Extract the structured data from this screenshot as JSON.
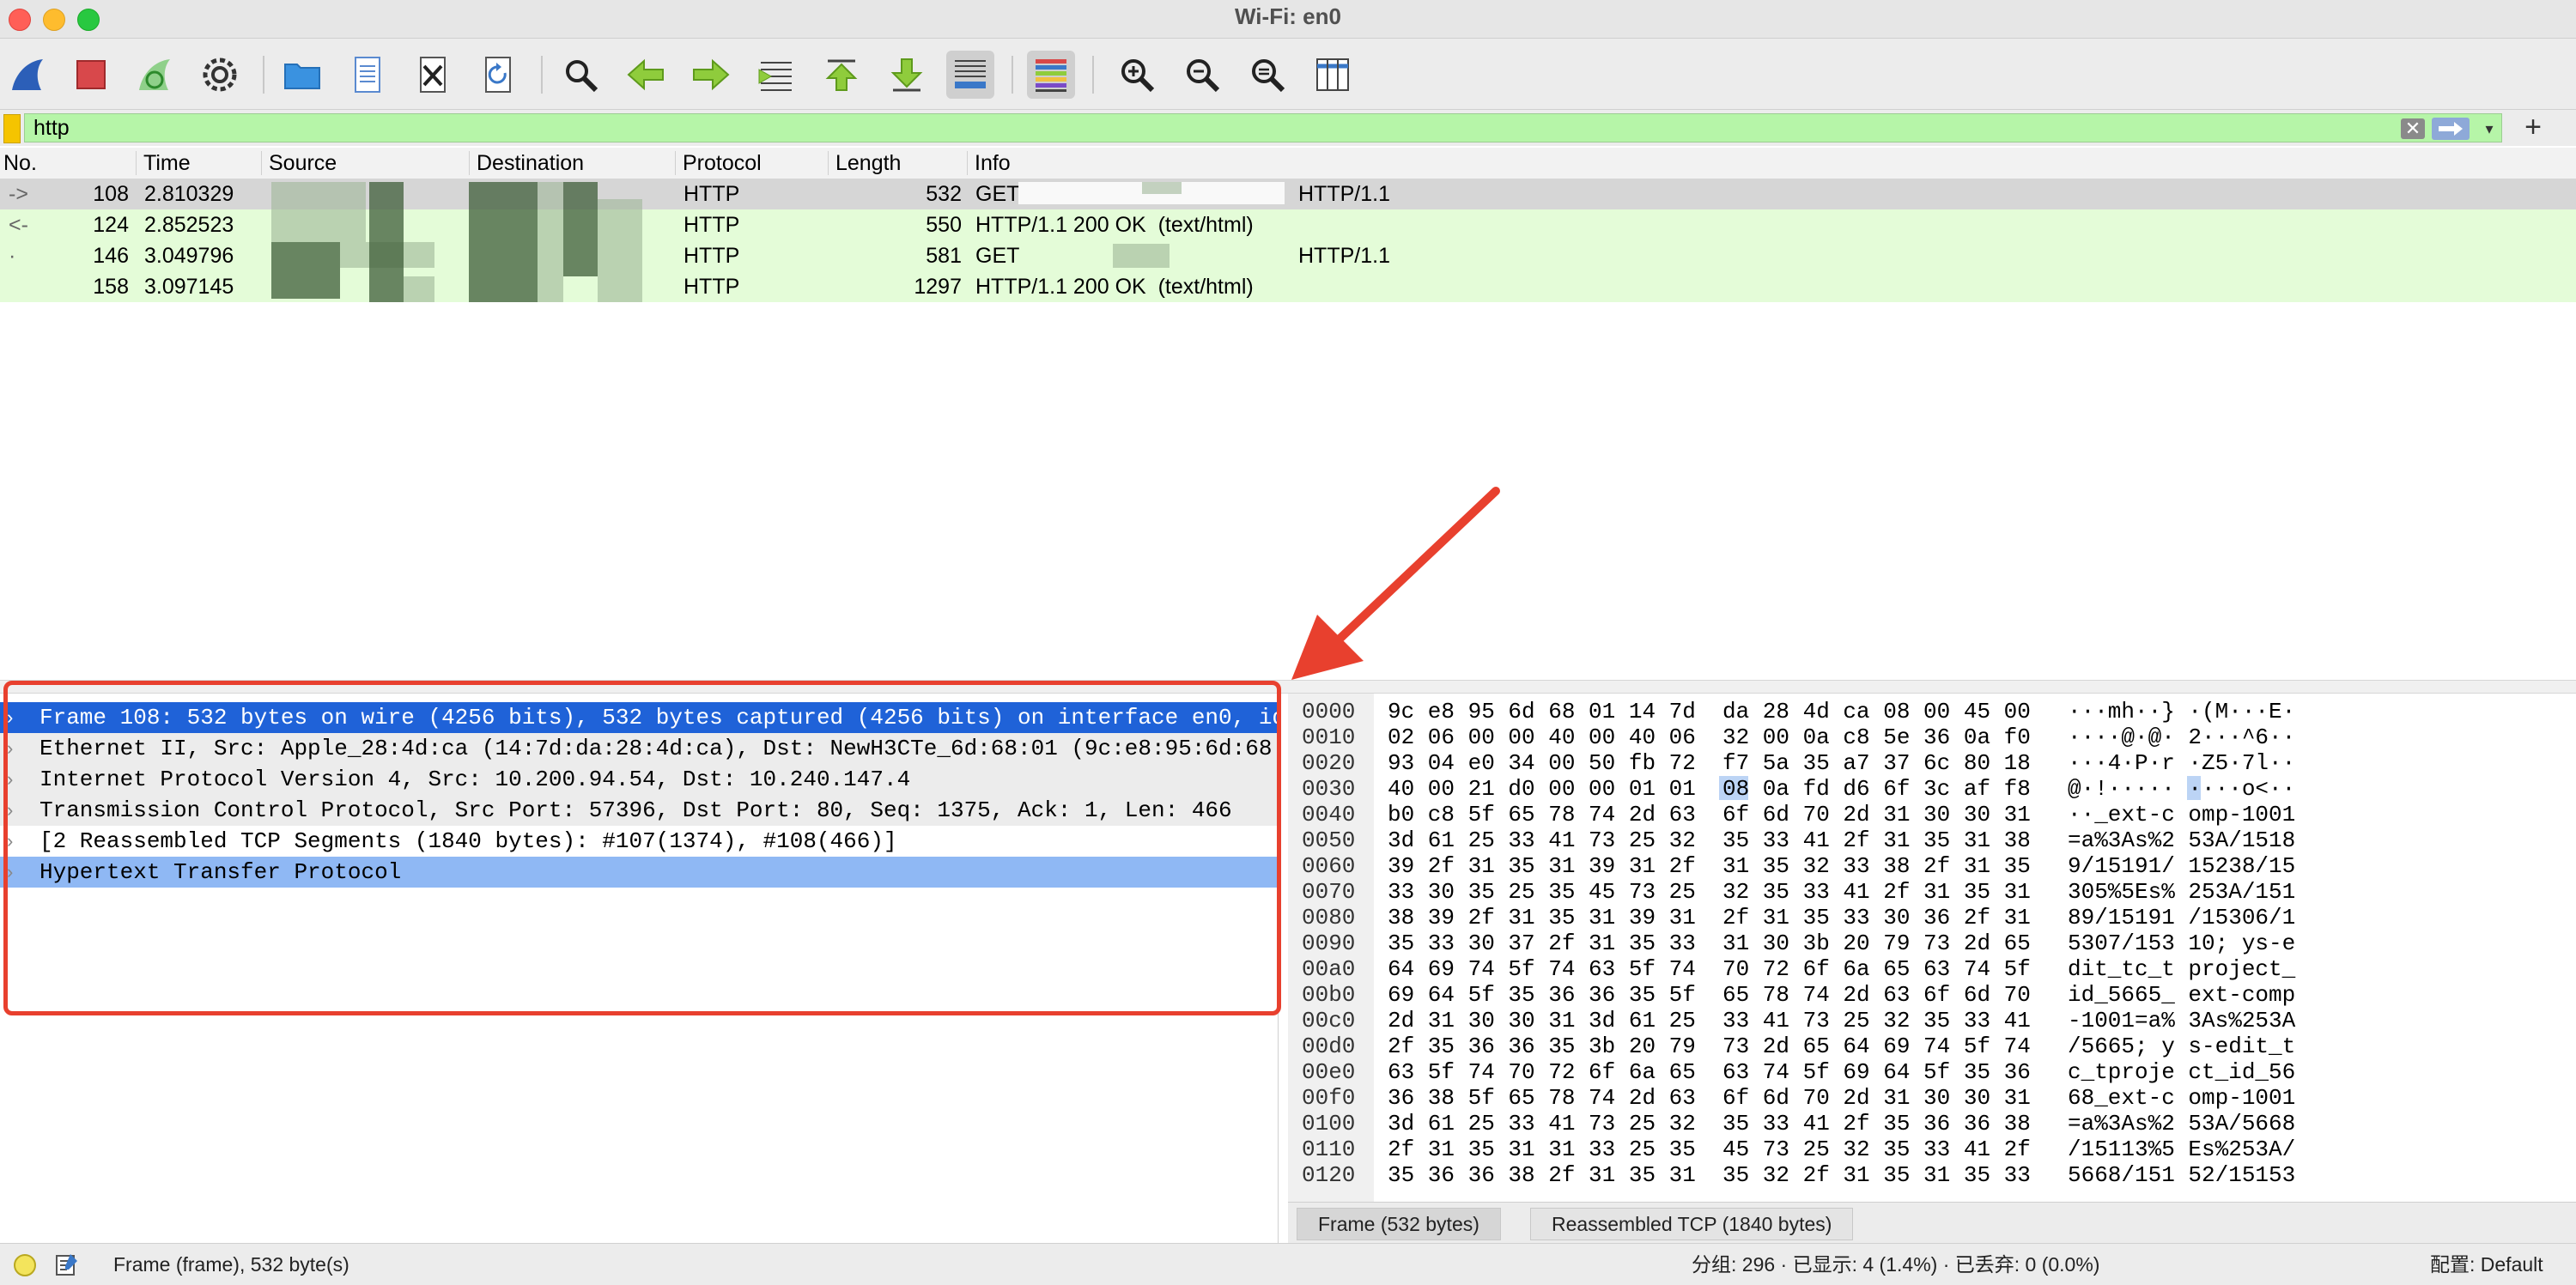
{
  "window": {
    "title": "Wi-Fi: en0"
  },
  "toolbar": {
    "icons": [
      "shark-fin-start-icon",
      "stop-square-icon",
      "restart-fin-icon",
      "gear-options-icon",
      "folder-open-icon",
      "file-save-icon",
      "file-close-icon",
      "reload-icon",
      "find-magnifier-icon",
      "go-back-arrow-icon",
      "go-forward-arrow-icon",
      "go-to-packet-icon",
      "first-packet-icon",
      "last-packet-icon",
      "autoscroll-icon",
      "colorize-icon",
      "zoom-in-icon",
      "zoom-out-icon",
      "zoom-normal-icon",
      "resize-columns-icon"
    ]
  },
  "filter": {
    "value": "http"
  },
  "packet_list": {
    "columns": [
      "No.",
      "Time",
      "Source",
      "Destination",
      "Protocol",
      "Length",
      "Info"
    ],
    "rows": [
      {
        "no": "108",
        "time": "2.810329",
        "protocol": "HTTP",
        "length": "532",
        "info_pre": "GET",
        "info_post": "HTTP/1.1",
        "bg": "#d6d6d6"
      },
      {
        "no": "124",
        "time": "2.852523",
        "protocol": "HTTP",
        "length": "550",
        "info_pre": "HTTP/1.1 200 OK  (text/html)",
        "info_post": "",
        "bg": "#e4fcd8"
      },
      {
        "no": "146",
        "time": "3.049796",
        "protocol": "HTTP",
        "length": "581",
        "info_pre": "GET",
        "info_post": "HTTP/1.1",
        "bg": "#e4fcd8"
      },
      {
        "no": "158",
        "time": "3.097145",
        "protocol": "HTTP",
        "length": "1297",
        "info_pre": "HTTP/1.1 200 OK  (text/html)",
        "info_post": "",
        "bg": "#e4fcd8"
      }
    ]
  },
  "details": {
    "rows": [
      {
        "text": "Frame 108: 532 bytes on wire (4256 bits), 532 bytes captured (4256 bits) on interface en0, id",
        "state": "selected"
      },
      {
        "text": "Ethernet II, Src: Apple_28:4d:ca (14:7d:da:28:4d:ca), Dst: NewH3CTe_6d:68:01 (9c:e8:95:6d:68",
        "state": "normal"
      },
      {
        "text": "Internet Protocol Version 4, Src: 10.200.94.54, Dst: 10.240.147.4",
        "state": "normal"
      },
      {
        "text": "Transmission Control Protocol, Src Port: 57396, Dst Port: 80, Seq: 1375, Ack: 1, Len: 466",
        "state": "normal"
      },
      {
        "text": "[2 Reassembled TCP Segments (1840 bytes): #107(1374), #108(466)]",
        "state": "plain"
      },
      {
        "text": "Hypertext Transfer Protocol",
        "state": "highlight"
      }
    ]
  },
  "bytes": {
    "rows": [
      {
        "offset": "0000",
        "hex1": "9c e8 95 6d 68 01 14 7d",
        "hex2": "da 28 4d ca 08 00 45 00",
        "ascii": "···mh··} ·(M···E·"
      },
      {
        "offset": "0010",
        "hex1": "02 06 00 00 40 00 40 06",
        "hex2": "32 00 0a c8 5e 36 0a f0",
        "ascii": "····@·@· 2···^6··"
      },
      {
        "offset": "0020",
        "hex1": "93 04 e0 34 00 50 fb 72",
        "hex2": "f7 5a 35 a7 37 6c 80 18",
        "ascii": "···4·P·r ·Z5·7l··"
      },
      {
        "offset": "0030",
        "hex1": "40 00 21 d0 00 00 01 01",
        "hex2": "08 0a fd d6 6f 3c af f8",
        "ascii": "@·!····· ····o<··"
      },
      {
        "offset": "0040",
        "hex1": "b0 c8 5f 65 78 74 2d 63",
        "hex2": "6f 6d 70 2d 31 30 30 31",
        "ascii": "··_ext-c omp-1001"
      },
      {
        "offset": "0050",
        "hex1": "3d 61 25 33 41 73 25 32",
        "hex2": "35 33 41 2f 31 35 31 38",
        "ascii": "=a%3As%2 53A/1518"
      },
      {
        "offset": "0060",
        "hex1": "39 2f 31 35 31 39 31 2f",
        "hex2": "31 35 32 33 38 2f 31 35",
        "ascii": "9/15191/ 15238/15"
      },
      {
        "offset": "0070",
        "hex1": "33 30 35 25 35 45 73 25",
        "hex2": "32 35 33 41 2f 31 35 31",
        "ascii": "305%5Es% 253A/151"
      },
      {
        "offset": "0080",
        "hex1": "38 39 2f 31 35 31 39 31",
        "hex2": "2f 31 35 33 30 36 2f 31",
        "ascii": "89/15191 /15306/1"
      },
      {
        "offset": "0090",
        "hex1": "35 33 30 37 2f 31 35 33",
        "hex2": "31 30 3b 20 79 73 2d 65",
        "ascii": "5307/153 10; ys-e"
      },
      {
        "offset": "00a0",
        "hex1": "64 69 74 5f 74 63 5f 74",
        "hex2": "70 72 6f 6a 65 63 74 5f",
        "ascii": "dit_tc_t project_"
      },
      {
        "offset": "00b0",
        "hex1": "69 64 5f 35 36 36 35 5f",
        "hex2": "65 78 74 2d 63 6f 6d 70",
        "ascii": "id_5665_ ext-comp"
      },
      {
        "offset": "00c0",
        "hex1": "2d 31 30 30 31 3d 61 25",
        "hex2": "33 41 73 25 32 35 33 41",
        "ascii": "-1001=a% 3As%253A"
      },
      {
        "offset": "00d0",
        "hex1": "2f 35 36 36 35 3b 20 79",
        "hex2": "73 2d 65 64 69 74 5f 74",
        "ascii": "/5665; y s-edit_t"
      },
      {
        "offset": "00e0",
        "hex1": "63 5f 74 70 72 6f 6a 65",
        "hex2": "63 74 5f 69 64 5f 35 36",
        "ascii": "c_tproje ct_id_56"
      },
      {
        "offset": "00f0",
        "hex1": "36 38 5f 65 78 74 2d 63",
        "hex2": "6f 6d 70 2d 31 30 30 31",
        "ascii": "68_ext-c omp-1001"
      },
      {
        "offset": "0100",
        "hex1": "3d 61 25 33 41 73 25 32",
        "hex2": "35 33 41 2f 35 36 36 38",
        "ascii": "=a%3As%2 53A/5668"
      },
      {
        "offset": "0110",
        "hex1": "2f 31 35 31 31 33 25 35",
        "hex2": "45 73 25 32 35 33 41 2f",
        "ascii": "/15113%5 Es%253A/"
      },
      {
        "offset": "0120",
        "hex1": "35 36 36 38 2f 31 35 31",
        "hex2": "35 32 2f 31 35 31 35 33",
        "ascii": "5668/151 52/15153"
      }
    ],
    "tabs": [
      "Frame (532 bytes)",
      "Reassembled TCP (1840 bytes)"
    ]
  },
  "status": {
    "left": "Frame (frame), 532 byte(s)",
    "stats": "分组: 296 · 已显示: 4 (1.4%) · 已丢弃: 0 (0.0%)",
    "profile": "配置: Default"
  },
  "colors": {
    "selected_row": "#1f62d8",
    "highlight_row": "#8fb8f4",
    "filter_bg": "#b6f5a8",
    "http_row_bg": "#e4fcd8",
    "annotation_red": "#e8402e"
  }
}
